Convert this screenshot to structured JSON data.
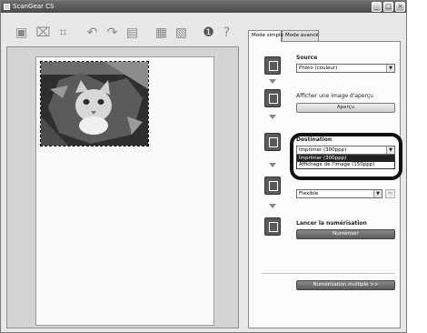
{
  "window": {
    "title": "ScanGear CS",
    "controls": {
      "minimize": "_",
      "maximize": "□",
      "close": "×"
    }
  },
  "toolbar": {
    "tools": [
      {
        "name": "thumbnail-icon",
        "glyph": "▣"
      },
      {
        "name": "auto-crop-icon",
        "glyph": "⌧"
      },
      {
        "name": "crop-icon",
        "glyph": "⌗"
      },
      {
        "name": "rotate-left-icon",
        "glyph": "↶"
      },
      {
        "name": "rotate-right-icon",
        "glyph": "↷"
      },
      {
        "name": "scan-icon",
        "glyph": "▤"
      },
      {
        "name": "select-all-icon",
        "glyph": "▦"
      },
      {
        "name": "deselect-icon",
        "glyph": "▧"
      },
      {
        "name": "info-icon",
        "glyph": "❶"
      },
      {
        "name": "help-icon",
        "glyph": "?"
      }
    ]
  },
  "tabs": [
    {
      "label": "Mode simple",
      "active": true
    },
    {
      "label": "Mode avancé",
      "active": false
    }
  ],
  "source": {
    "label": "Source",
    "value": "Photo (couleur)"
  },
  "preview": {
    "label": "Afficher une image d'aperçu",
    "button": "Aperçu"
  },
  "destination": {
    "label": "Destination",
    "value": "Imprimer (300ppp)",
    "options": [
      "Imprimer (300ppp)",
      "Affichage de l'image (150ppp)"
    ],
    "selected_index": 0
  },
  "output_size": {
    "value": "Flexible"
  },
  "scan": {
    "label": "Lancer la numérisation",
    "button": "Numériser"
  },
  "multi_scan": {
    "button": "Numérisation multiple >>"
  }
}
